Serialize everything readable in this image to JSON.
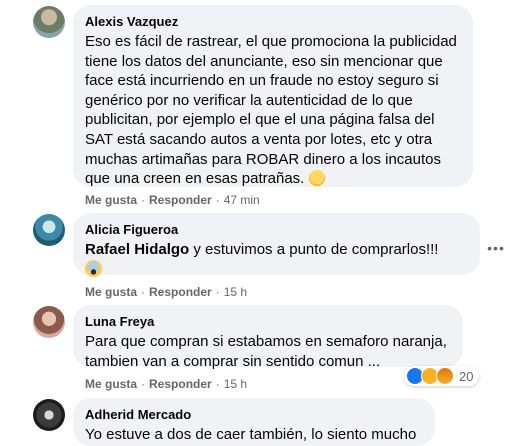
{
  "colors": {
    "bubble_bg": "#f0f2f5",
    "meta_text": "#65676b",
    "like_blue": "#1877f2",
    "haha_yellow": "#f7b125"
  },
  "comments": [
    {
      "author": "Alexis Vazquez",
      "text": "Eso es fácil de rastrear, el que promociona la publicidad tiene los datos del anunciante, eso sin mencionar que face está incurriendo en un fraude no estoy seguro si genérico por no verificar la autenticidad de lo que publicitan, por ejemplo el que el una página falsa del SAT está sacando autos a venta por lotes, etc y otra muchas artimañas para ROBAR dinero a los incautos que una creen en esas patrañas.",
      "emoji": "thinking-face-icon",
      "like": "Me gusta",
      "reply": "Responder",
      "time": "47 min"
    },
    {
      "author": "Alicia Figueroa",
      "mention": "Rafael Hidalgo",
      "text": " y estuvimos a punto de comprarlos!!!",
      "emoji": "screaming-face-icon",
      "like": "Me gusta",
      "reply": "Responder",
      "time": "15 h",
      "more": "•••"
    },
    {
      "author": "Luna Freya",
      "text": "Para que compran si estabamos en semaforo naranja, tambien van a comprar sin sentido comun ...",
      "like": "Me gusta",
      "reply": "Responder",
      "time": "15 h",
      "reactions": {
        "icons": [
          "like-reaction-icon",
          "haha-reaction-icon",
          "angry-reaction-icon"
        ],
        "count": "20"
      }
    },
    {
      "author": "Adherid Mercado",
      "text": "Yo estuve a dos de caer también, lo siento mucho"
    }
  ]
}
